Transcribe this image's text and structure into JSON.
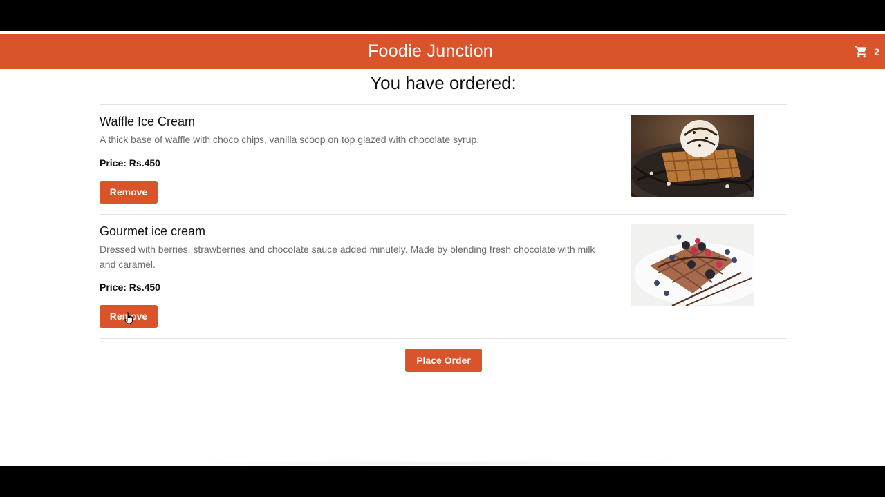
{
  "navbar": {
    "brand": "Foodie Junction",
    "cart_icon": "shopping-cart-icon",
    "cart_count": "2",
    "color": "#d9542b"
  },
  "main": {
    "heading": "You have ordered:",
    "items": [
      {
        "name": "Waffle Ice Cream",
        "description": "A thick base of waffle with choco chips, vanilla scoop on top glazed with chocolate syrup.",
        "price": "Price: Rs.450",
        "remove_label": "Remove",
        "image": "waffle-ice-cream-photo"
      },
      {
        "name": "Gourmet ice cream",
        "description": "Dressed with berries, strawberries and chocolate sauce added minutely. Made by blending fresh chocolate with milk and caramel.",
        "price": "Price: Rs.450",
        "remove_label": "Remove",
        "image": "gourmet-ice-cream-photo"
      }
    ],
    "place_order_label": "Place Order"
  }
}
